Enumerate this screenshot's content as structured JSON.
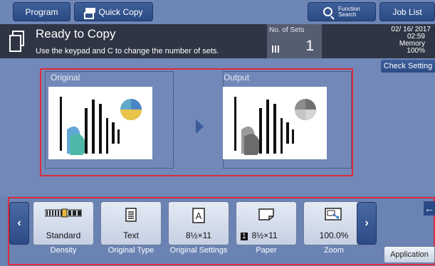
{
  "topbar": {
    "program_label": "Program",
    "quick_copy_label": "Quick Copy",
    "function_search_line1": "Function",
    "function_search_line2": "Search",
    "job_list_label": "Job List"
  },
  "status": {
    "title": "Ready to Copy",
    "message": "Use the keypad and C to change the number of sets.",
    "sets_label": "No. of Sets",
    "sets_value": "1",
    "date": "02/ 16/ 2017",
    "time": "02:59",
    "memory_label": "Memory",
    "memory_value": "100%"
  },
  "preview": {
    "check_setting_label": "Check Setting",
    "original_label": "Original",
    "output_label": "Output"
  },
  "functions": {
    "keys": [
      {
        "num": "1",
        "value": "Standard",
        "label": "Density"
      },
      {
        "num": "2",
        "value": "Text",
        "label": "Original Type"
      },
      {
        "num": "3",
        "value": "8½×11",
        "label": "Original Settings"
      },
      {
        "num": "4",
        "tray": "1",
        "value": "8½×11",
        "label": "Paper"
      },
      {
        "num": "5",
        "value": "100.0%",
        "label": "Zoom"
      }
    ],
    "application_label": "Application"
  },
  "colors": {
    "highlight_frame": "#dc2d3c",
    "status_bar": "#2f3544",
    "main_bg": "#7288b8"
  }
}
